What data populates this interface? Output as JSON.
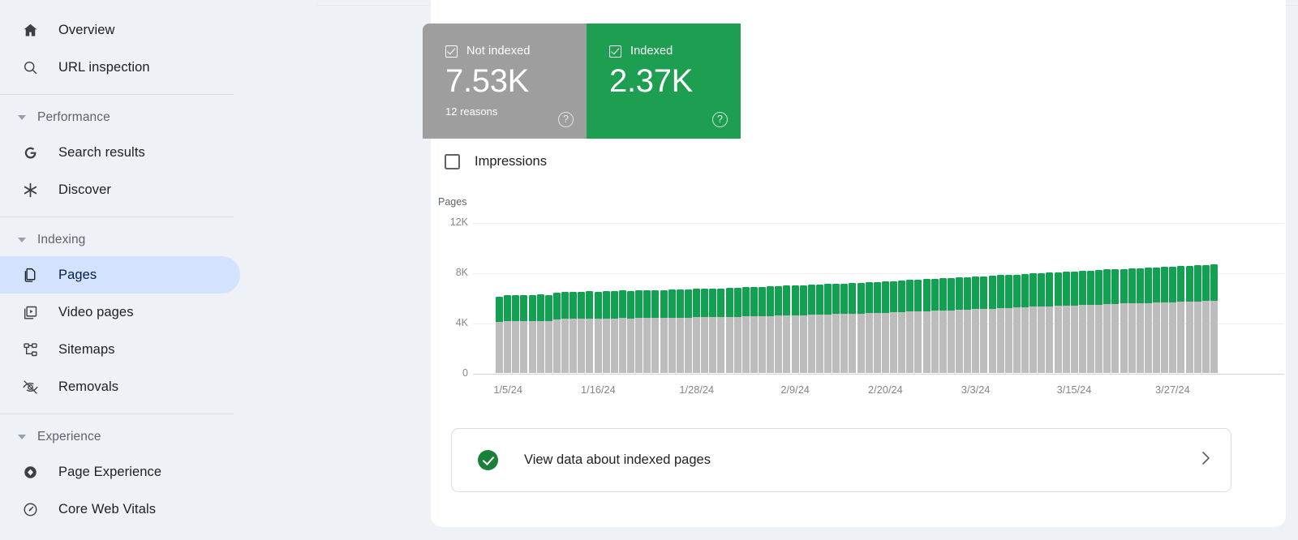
{
  "sidebar": {
    "items": [
      {
        "label": "Overview",
        "icon": "home-icon",
        "name": "sidebar-item-overview",
        "active": false
      },
      {
        "label": "URL inspection",
        "icon": "search-icon",
        "name": "sidebar-item-url-inspection",
        "active": false
      }
    ],
    "groups": [
      {
        "label": "Performance",
        "name": "sidebar-group-performance",
        "items": [
          {
            "label": "Search results",
            "icon": "google-g-icon",
            "name": "sidebar-item-search-results",
            "active": false
          },
          {
            "label": "Discover",
            "icon": "asterisk-icon",
            "name": "sidebar-item-discover",
            "active": false
          }
        ]
      },
      {
        "label": "Indexing",
        "name": "sidebar-group-indexing",
        "items": [
          {
            "label": "Pages",
            "icon": "pages-icon",
            "name": "sidebar-item-pages",
            "active": true
          },
          {
            "label": "Video pages",
            "icon": "video-pages-icon",
            "name": "sidebar-item-video-pages",
            "active": false
          },
          {
            "label": "Sitemaps",
            "icon": "sitemaps-icon",
            "name": "sidebar-item-sitemaps",
            "active": false
          },
          {
            "label": "Removals",
            "icon": "eye-off-icon",
            "name": "sidebar-item-removals",
            "active": false
          }
        ]
      },
      {
        "label": "Experience",
        "name": "sidebar-group-experience",
        "items": [
          {
            "label": "Page Experience",
            "icon": "page-experience-icon",
            "name": "sidebar-item-page-experience",
            "active": false
          },
          {
            "label": "Core Web Vitals",
            "icon": "gauge-icon",
            "name": "sidebar-item-core-web-vitals",
            "active": false
          }
        ]
      }
    ]
  },
  "cards": {
    "not_indexed": {
      "title": "Not indexed",
      "value": "7.53K",
      "subtitle": "12 reasons",
      "color": "#9e9e9e",
      "checked": true,
      "help": "?"
    },
    "indexed": {
      "title": "Indexed",
      "value": "2.37K",
      "subtitle": "",
      "color": "#1e9e51",
      "checked": true,
      "help": "?"
    }
  },
  "impressions": {
    "label": "Impressions",
    "checked": false
  },
  "cta": {
    "label": "View data about indexed pages",
    "chevron": "›"
  },
  "chart_data": {
    "type": "bar",
    "title": "",
    "xlabel": "",
    "ylabel": "Pages",
    "ylim": [
      0,
      12000
    ],
    "yticks": [
      0,
      4000,
      8000,
      12000
    ],
    "ytick_labels": [
      "0",
      "4K",
      "8K",
      "12K"
    ],
    "grid": true,
    "stacked": true,
    "legend_position": "top",
    "xtick_labels": [
      "1/5/24",
      "1/16/24",
      "1/28/24",
      "2/9/24",
      "2/20/24",
      "3/3/24",
      "3/15/24",
      "3/27/24"
    ],
    "xtick_indices": [
      1,
      12,
      24,
      36,
      47,
      58,
      70,
      82
    ],
    "series": [
      {
        "name": "Not indexed",
        "color": "#bdbdbd",
        "values": [
          4060,
          4110,
          4120,
          4120,
          4130,
          4140,
          4130,
          4280,
          4300,
          4310,
          4300,
          4320,
          4310,
          4340,
          4350,
          4360,
          4340,
          4370,
          4380,
          4360,
          4390,
          4400,
          4420,
          4410,
          4430,
          4440,
          4450,
          4460,
          4470,
          4480,
          4500,
          4510,
          4530,
          4540,
          4560,
          4580,
          4590,
          4600,
          4620,
          4640,
          4660,
          4680,
          4700,
          4720,
          4740,
          4760,
          4780,
          4800,
          4830,
          4860,
          4880,
          4900,
          4930,
          4950,
          4980,
          5000,
          5030,
          5060,
          5080,
          5100,
          5130,
          5160,
          5180,
          5200,
          5230,
          5260,
          5280,
          5300,
          5330,
          5360,
          5380,
          5400,
          5430,
          5450,
          5480,
          5500,
          5520,
          5540,
          5560,
          5580,
          5600,
          5620,
          5640,
          5660,
          5680,
          5700,
          5720,
          5740
        ]
      },
      {
        "name": "Indexed",
        "color": "#12a150",
        "values": [
          2030,
          2060,
          2070,
          2060,
          2080,
          2090,
          2080,
          2130,
          2150,
          2160,
          2150,
          2170,
          2160,
          2180,
          2190,
          2200,
          2180,
          2200,
          2210,
          2190,
          2220,
          2230,
          2240,
          2230,
          2250,
          2260,
          2270,
          2280,
          2290,
          2300,
          2310,
          2320,
          2330,
          2340,
          2350,
          2360,
          2370,
          2380,
          2390,
          2400,
          2410,
          2420,
          2430,
          2440,
          2450,
          2460,
          2470,
          2480,
          2490,
          2500,
          2510,
          2520,
          2530,
          2540,
          2550,
          2560,
          2570,
          2580,
          2590,
          2600,
          2610,
          2620,
          2630,
          2640,
          2650,
          2660,
          2670,
          2680,
          2690,
          2700,
          2710,
          2720,
          2730,
          2740,
          2750,
          2760,
          2770,
          2780,
          2790,
          2800,
          2810,
          2820,
          2830,
          2840,
          2850,
          2860,
          2870,
          2880
        ]
      }
    ]
  }
}
